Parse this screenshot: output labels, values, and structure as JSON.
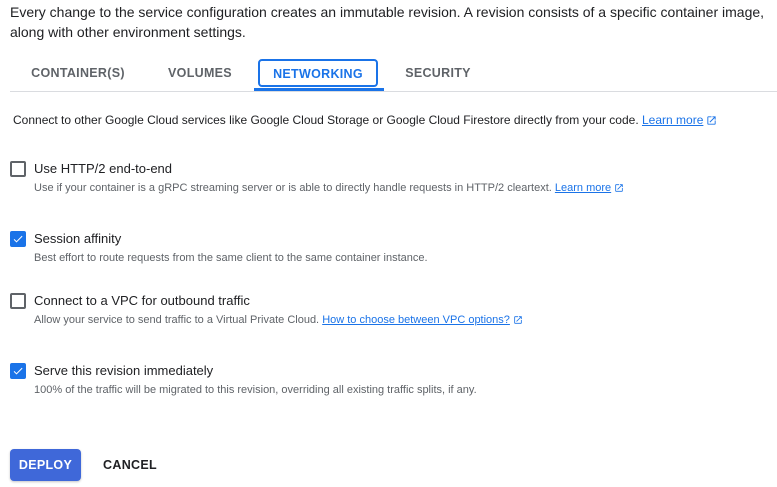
{
  "intro": "Every change to the service configuration creates an immutable revision. A revision consists of a specific container image, along with other environment settings.",
  "tabs": [
    {
      "label": "CONTAINER(S)"
    },
    {
      "label": "VOLUMES"
    },
    {
      "label": "NETWORKING",
      "active": true
    },
    {
      "label": "SECURITY"
    }
  ],
  "networking": {
    "description": "Connect to other Google Cloud services like Google Cloud Storage or Google Cloud Firestore directly from your code.",
    "learn_more": "Learn more"
  },
  "options": [
    {
      "label": "Use HTTP/2 end-to-end",
      "checked": false,
      "help": "Use if your container is a gRPC streaming server or is able to directly handle requests in HTTP/2 cleartext.",
      "link": "Learn more"
    },
    {
      "label": "Session affinity",
      "checked": true,
      "help": "Best effort to route requests from the same client to the same container instance."
    },
    {
      "label": "Connect to a VPC for outbound traffic",
      "checked": false,
      "help": "Allow your service to send traffic to a Virtual Private Cloud.",
      "link": "How to choose between VPC options?"
    },
    {
      "label": "Serve this revision immediately",
      "checked": true,
      "help": "100% of the traffic will be migrated to this revision, overriding all existing traffic splits, if any."
    }
  ],
  "actions": {
    "deploy": "DEPLOY",
    "cancel": "CANCEL"
  },
  "colors": {
    "accent": "#1a73e8",
    "deploy_button": "#3f68d9"
  },
  "icons": {
    "external_link": "open-in-new-icon",
    "checkmark": "check-icon"
  }
}
